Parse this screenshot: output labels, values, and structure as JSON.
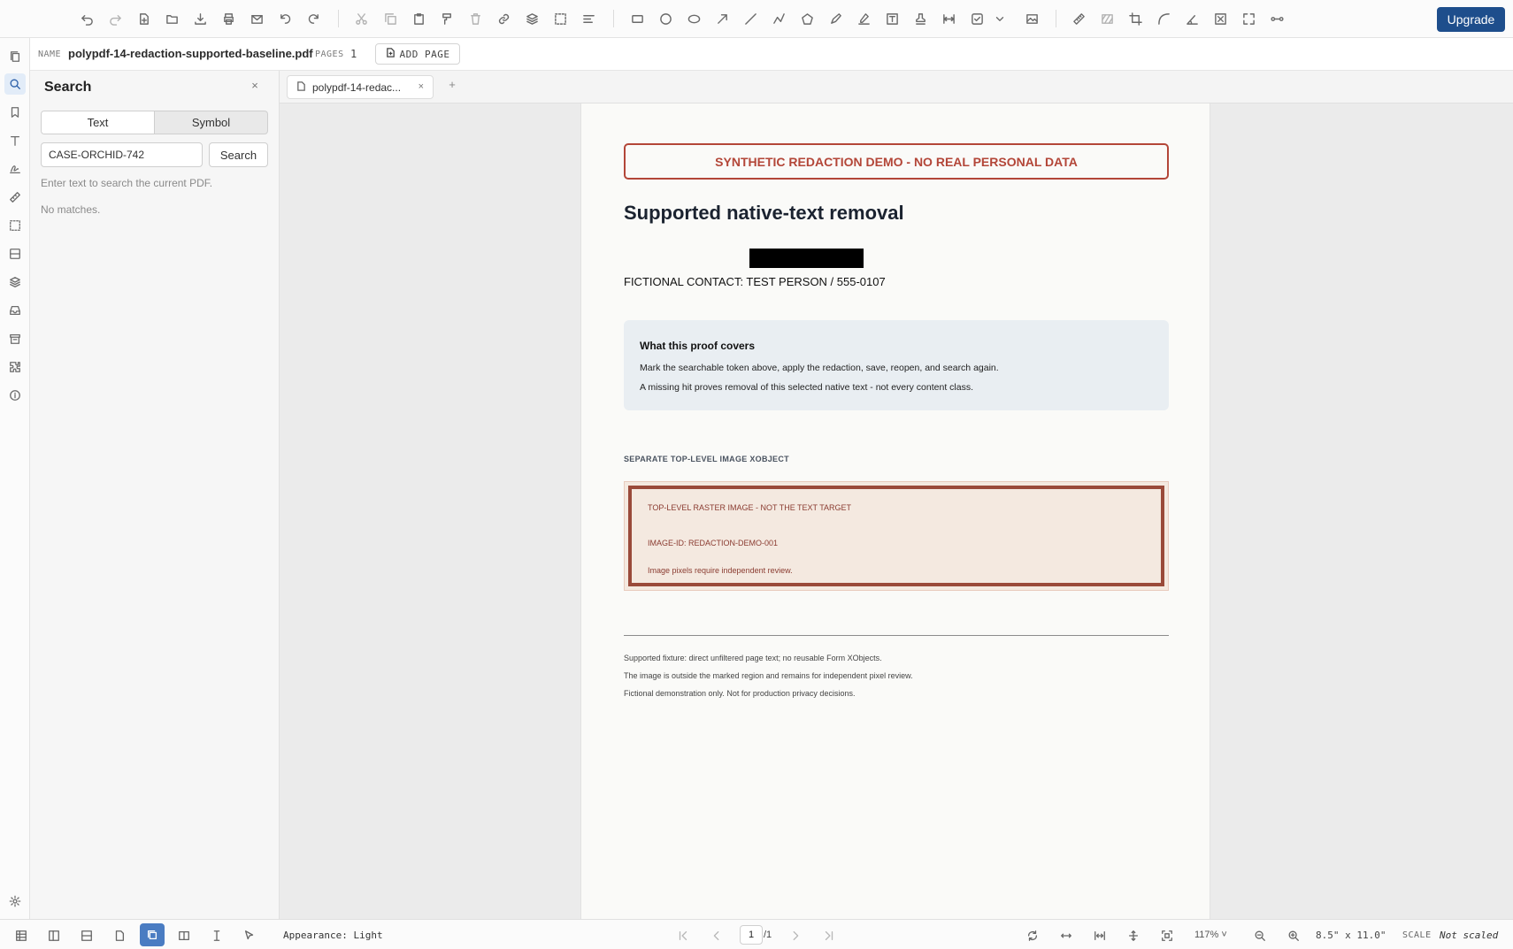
{
  "toolbar": {
    "upgrade_label": "Upgrade",
    "icons": [
      "undo-icon",
      "redo-icon",
      "new-file-icon",
      "open-folder-icon",
      "download-icon",
      "print-icon",
      "email-icon",
      "rotate-left-icon",
      "rotate-right-icon",
      "cut-icon",
      "copy-icon",
      "paste-icon",
      "format-painter-icon",
      "delete-icon",
      "link-icon",
      "layers-icon",
      "select-area-icon",
      "align-icon",
      "rectangle-icon",
      "circle-icon",
      "ellipse-icon",
      "arrow-icon",
      "line-icon",
      "polyline-icon",
      "polygon-icon",
      "pen-icon",
      "highlighter-icon",
      "text-box-icon",
      "stamp-icon",
      "measure-distance-icon",
      "checkbox-icon",
      "chevron-down-icon",
      "image-icon",
      "ruler-icon",
      "hatch-icon",
      "crop-icon",
      "curve-icon",
      "angle-icon",
      "clear-icon",
      "fullscreen-icon",
      "connector-icon"
    ]
  },
  "rail": {
    "items": [
      "pages-icon",
      "search-icon",
      "bookmark-icon",
      "text-icon",
      "signature-icon",
      "measure-icon",
      "selection-icon",
      "forms-icon",
      "layers-icon",
      "inbox-icon",
      "archive-icon",
      "plugins-icon",
      "info-icon"
    ],
    "settings_icon": "settings-icon"
  },
  "file": {
    "name_key": "NAME",
    "name": "polypdf-14-redaction-supported-baseline.pdf",
    "pages_key": "PAGES",
    "pages": "1",
    "add_page_label": "ADD PAGE"
  },
  "search": {
    "title": "Search",
    "close": "×",
    "tabs": [
      "Text",
      "Symbol"
    ],
    "query": "CASE-ORCHID-742",
    "button": "Search",
    "help": "Enter text to search the current PDF.",
    "result": "No matches."
  },
  "tabs": {
    "doc_label": "polypdf-14-redac...",
    "close": "×",
    "add": "+"
  },
  "document": {
    "banner": "SYNTHETIC REDACTION DEMO - NO REAL PERSONAL DATA",
    "heading": "Supported native-text removal",
    "contact": "FICTIONAL CONTACT: TEST PERSON / 555-0107",
    "proof_title": "What this proof covers",
    "proof_line1": "Mark the searchable token above, apply the redaction, save, reopen, and search again.",
    "proof_line2": "A missing hit proves removal of this selected native text - not every content class.",
    "section_label": "SEPARATE TOP-LEVEL IMAGE XOBJECT",
    "raster_line1": "TOP-LEVEL RASTER IMAGE - NOT THE TEXT TARGET",
    "raster_line2": "IMAGE-ID: REDACTION-DEMO-001",
    "raster_line3": "Image pixels require independent review.",
    "foot1": "Supported fixture: direct unfiltered page text; no reusable Form XObjects.",
    "foot2": "The image is outside the marked region and remains for independent pixel review.",
    "foot3": "Fictional demonstration only. Not for production privacy decisions."
  },
  "status": {
    "appearance": "Appearance: Light",
    "page_current": "1",
    "page_total": "/1",
    "zoom": "117% ˅",
    "page_size": "8.5\" x 11.0\"",
    "scale_key": "SCALE",
    "scale_value": "Not scaled"
  },
  "colors": {
    "accent": "#1e4e8c",
    "banner_red": "#b34638",
    "active_view": "#4a7cc2"
  }
}
